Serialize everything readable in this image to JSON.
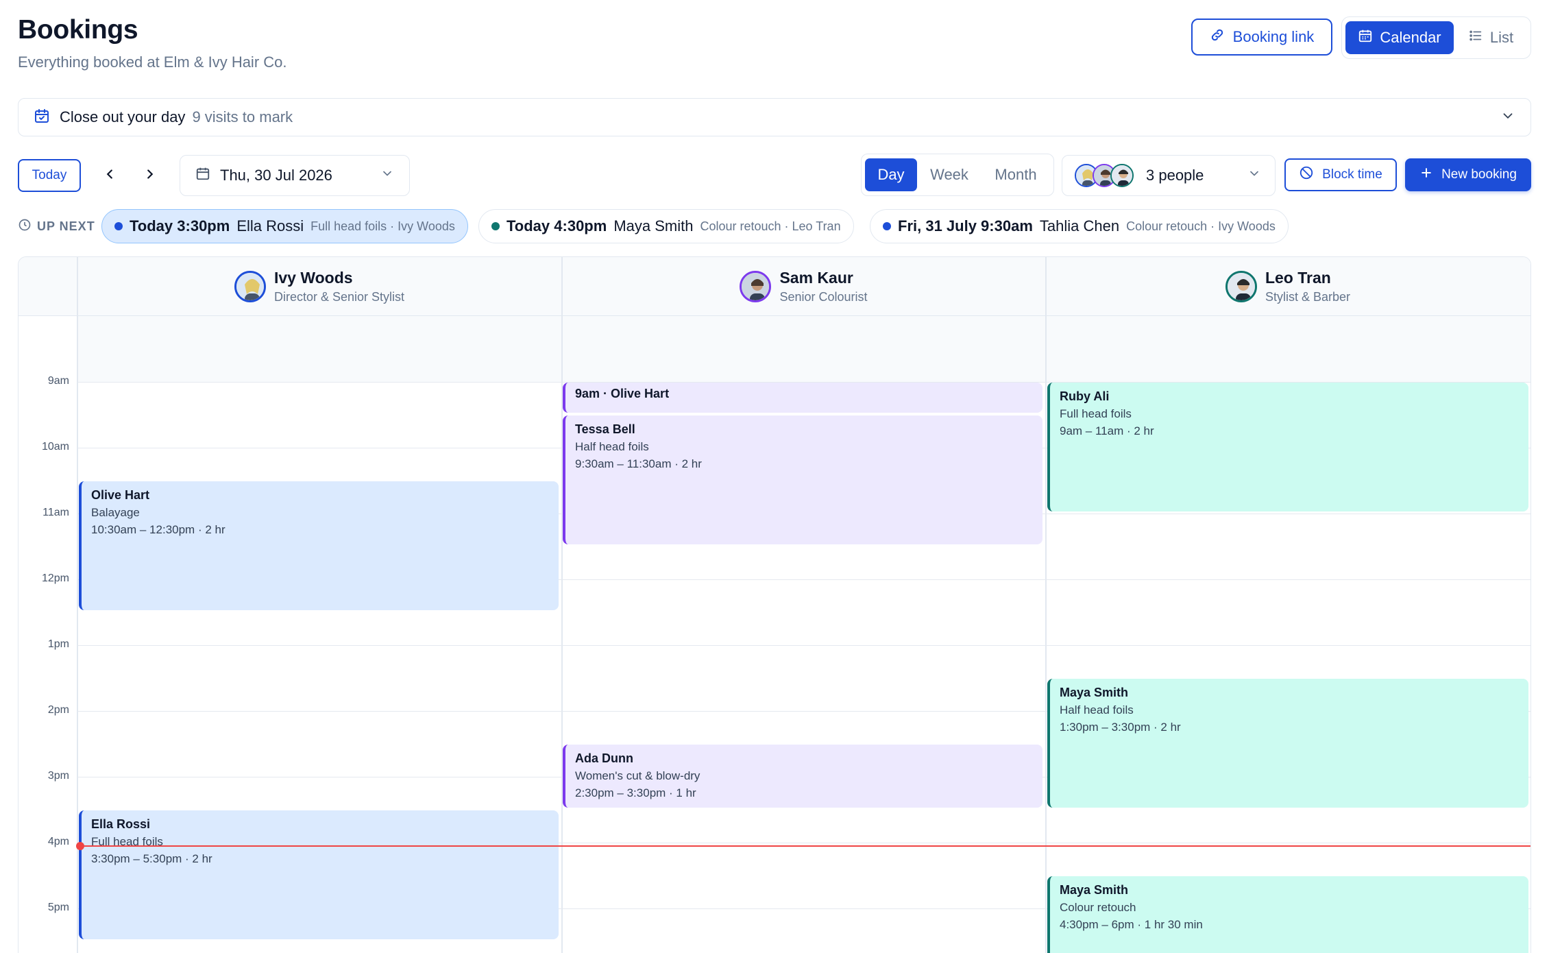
{
  "header": {
    "title": "Bookings",
    "subtitle": "Everything booked at Elm & Ivy Hair Co.",
    "booking_link_label": "Booking link",
    "view_calendar_label": "Calendar",
    "view_list_label": "List"
  },
  "closeout": {
    "label": "Close out your day",
    "count_text": "9 visits to mark"
  },
  "toolbar": {
    "today_label": "Today",
    "date_value": "Thu, 30 Jul 2026",
    "range": {
      "day": "Day",
      "week": "Week",
      "month": "Month",
      "selected": "Day"
    },
    "people_label": "3 people",
    "block_time_label": "Block time",
    "new_booking_label": "New booking"
  },
  "up_next": {
    "label": "UP NEXT",
    "items": [
      {
        "when": "Today 3:30pm",
        "client": "Ella Rossi",
        "detail": "Full head foils · Ivy Woods",
        "dot_color": "#1d4ed8"
      },
      {
        "when": "Today 4:30pm",
        "client": "Maya Smith",
        "detail": "Colour retouch · Leo Tran",
        "dot_color": "#0f766e"
      },
      {
        "when": "Fri, 31 July 9:30am",
        "client": "Tahlia Chen",
        "detail": "Colour retouch · Ivy Woods",
        "dot_color": "#1d4ed8"
      }
    ]
  },
  "staff": [
    {
      "name": "Ivy Woods",
      "role": "Director & Senior Stylist",
      "color": "#1d4ed8"
    },
    {
      "name": "Sam Kaur",
      "role": "Senior Colourist",
      "color": "#7c3aed"
    },
    {
      "name": "Leo Tran",
      "role": "Stylist & Barber",
      "color": "#0f766e"
    }
  ],
  "hours": [
    "9am",
    "10am",
    "11am",
    "12pm",
    "1pm",
    "2pm",
    "3pm",
    "4pm",
    "5pm"
  ],
  "events": {
    "ivy": [
      {
        "name": "Olive Hart",
        "service": "Balayage",
        "time": "10:30am – 12:30pm · 2 hr"
      },
      {
        "name": "Ella Rossi",
        "service": "Full head foils",
        "time": "3:30pm – 5:30pm · 2 hr"
      }
    ],
    "sam": [
      {
        "name": "9am · Olive Hart"
      },
      {
        "name": "Tessa Bell",
        "service": "Half head foils",
        "time": "9:30am – 11:30am · 2 hr"
      },
      {
        "name": "Ada Dunn",
        "service": "Women's cut & blow-dry",
        "time": "2:30pm – 3:30pm · 1 hr"
      }
    ],
    "leo": [
      {
        "name": "Ruby Ali",
        "service": "Full head foils",
        "time": "9am – 11am · 2 hr"
      },
      {
        "name": "Maya Smith",
        "service": "Half head foils",
        "time": "1:30pm – 3:30pm · 2 hr"
      },
      {
        "name": "Maya Smith",
        "service": "Colour retouch",
        "time": "4:30pm – 6pm · 1 hr 30 min"
      }
    ]
  },
  "colors": {
    "accent": "#1d4ed8",
    "now_line": "#ef4444"
  }
}
